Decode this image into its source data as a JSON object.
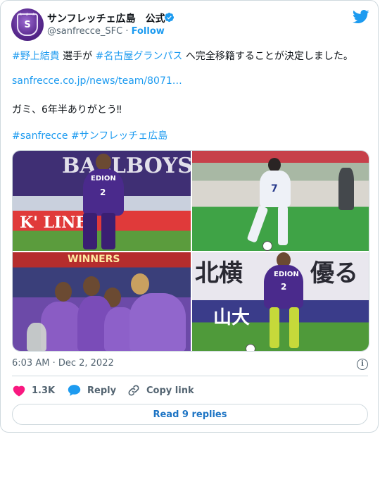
{
  "author": {
    "name": "サンフレッチェ広島　公式",
    "handle": "@sanfrecce_SFC",
    "separator": "·",
    "follow_label": "Follow"
  },
  "tweet": {
    "line1_tag1": "#野上結貴",
    "line1_text1": " 選手が ",
    "line1_tag2": "#名古屋グランパス",
    "line1_text2": " へ完全移籍することが決定しました。",
    "link": "sanfrecce.co.jp/news/team/8071…",
    "line3": "ガミ、6年半ありがとう‼",
    "hashtag_a": "#sanfrecce",
    "hashtag_b": "#サンフレッチェ広島"
  },
  "media": {
    "photo1_banner": "BALLBOYS",
    "photo1_board": "K' LINE",
    "photo1_shirt": "EDION",
    "photo1_number": "2",
    "photo2_number": "7",
    "photo3_banner": "WINNERS",
    "photo4_sign1": "北横",
    "photo4_sign2": "優る",
    "photo4_sign3": "山大",
    "photo4_shirt": "EDION",
    "photo4_number": "2"
  },
  "meta": {
    "timestamp": "6:03 AM · Dec 2, 2022"
  },
  "actions": {
    "likes": "1.3K",
    "reply": "Reply",
    "copy_link": "Copy link",
    "read_replies": "Read 9 replies"
  },
  "colors": {
    "accent": "#1d9bf0",
    "like": "#f91880",
    "text": "#0f1419",
    "muted": "#536471"
  },
  "icons": [
    "twitter-bird-icon",
    "verified-badge-icon",
    "heart-icon",
    "reply-bubble-icon",
    "link-icon",
    "info-icon"
  ]
}
